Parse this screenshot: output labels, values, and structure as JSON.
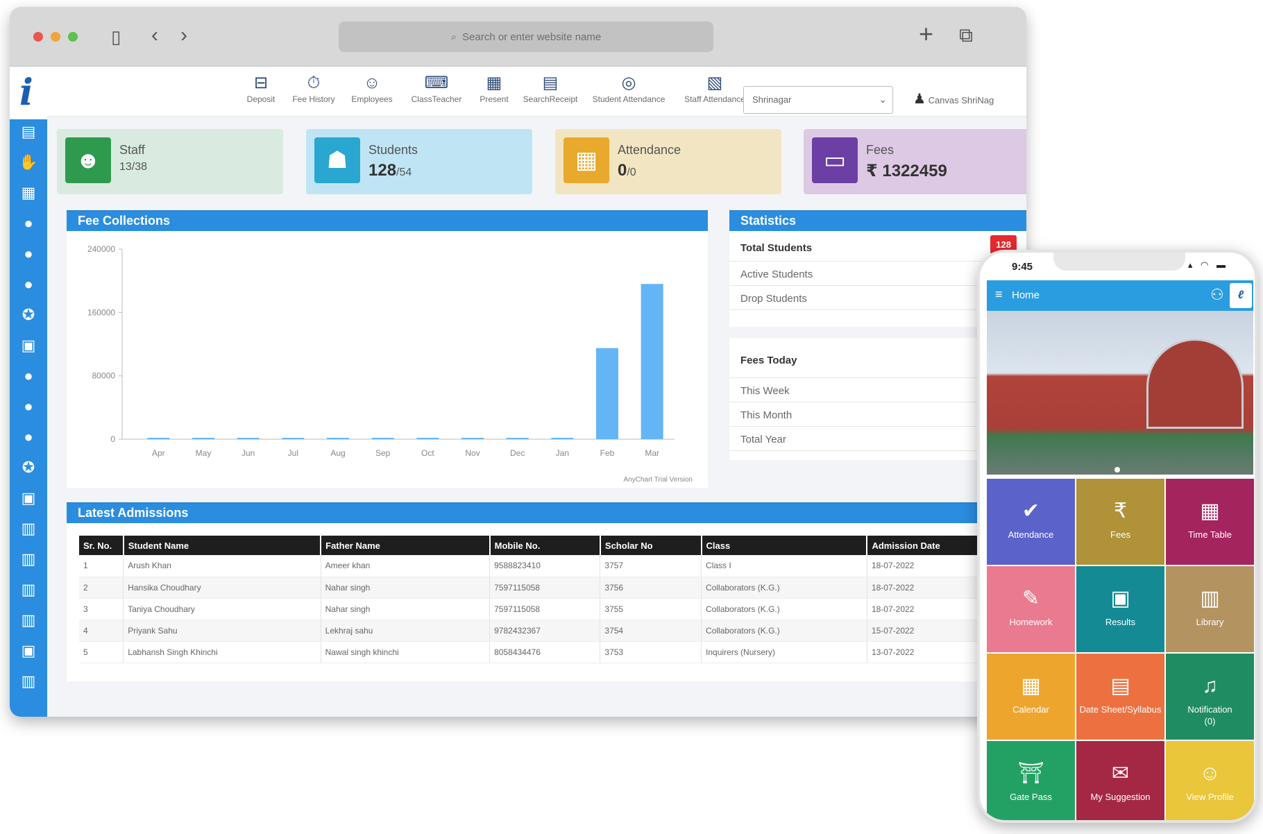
{
  "browser": {
    "url_placeholder": "Search or enter website name"
  },
  "toolbar": {
    "items": [
      {
        "label": "Deposit",
        "icon": "deposit-icon"
      },
      {
        "label": "Fee History",
        "icon": "fee-history-icon"
      },
      {
        "label": "Employees",
        "icon": "employees-icon"
      },
      {
        "label": "ClassTeacher",
        "icon": "class-teacher-icon"
      },
      {
        "label": "Present",
        "icon": "calendar-icon"
      },
      {
        "label": "SearchReceipt",
        "icon": "receipt-icon"
      },
      {
        "label": "Student Attendance",
        "icon": "student-attendance-icon"
      },
      {
        "label": "Staff Attendance",
        "icon": "staff-attendance-icon"
      }
    ],
    "branch_select": "Shrinagar",
    "user_name": "Canvas ShriNag"
  },
  "cards": {
    "staff": {
      "title": "Staff",
      "value": "13",
      "total": "/38",
      "color": "#2e9a4e"
    },
    "students": {
      "title": "Students",
      "value": "128",
      "total": "/54",
      "color": "#2aa7d0"
    },
    "attendance": {
      "title": "Attendance",
      "value": "0",
      "total": "/0",
      "color": "#e9a92c"
    },
    "fees": {
      "title": "Fees",
      "value": "₹ 1322459",
      "color": "#6c3fa5"
    }
  },
  "fee_panel": {
    "title": "Fee Collections",
    "watermark": "AnyChart Trial Version"
  },
  "chart_data": {
    "type": "bar",
    "categories": [
      "Apr",
      "May",
      "Jun",
      "Jul",
      "Aug",
      "Sep",
      "Oct",
      "Nov",
      "Dec",
      "Jan",
      "Feb",
      "Mar"
    ],
    "values": [
      0,
      0,
      0,
      0,
      0,
      0,
      0,
      0,
      0,
      0,
      115000,
      196000
    ],
    "ylim": [
      0,
      240000
    ],
    "yticks": [
      "0",
      "80000",
      "160000",
      "240000"
    ],
    "title": "",
    "xlabel": "",
    "ylabel": "",
    "grid": false,
    "bar_color": "#64b5f6"
  },
  "statistics": {
    "title": "Statistics",
    "total_students_label": "Total Students",
    "total_students_badge": "128",
    "rows": [
      "Active Students",
      "Drop Students"
    ]
  },
  "fees_today": {
    "label": "Fees Today",
    "badge": "₹",
    "rows": [
      "This Week",
      "This Month",
      "Total Year"
    ]
  },
  "admissions": {
    "title": "Latest Admissions",
    "columns": [
      "Sr. No.",
      "Student Name",
      "Father Name",
      "Mobile No.",
      "Scholar No",
      "Class",
      "Admission Date"
    ],
    "rows": [
      [
        "1",
        "Arush Khan",
        "Ameer khan",
        "9588823410",
        "3757",
        "Class I",
        "18-07-2022"
      ],
      [
        "2",
        "Hansika Choudhary",
        "Nahar singh",
        "7597115058",
        "3756",
        "Collaborators (K.G.)",
        "18-07-2022"
      ],
      [
        "3",
        "Taniya Choudhary",
        "Nahar singh",
        "7597115058",
        "3755",
        "Collaborators (K.G.)",
        "18-07-2022"
      ],
      [
        "4",
        "Priyank Sahu",
        "Lekhraj sahu",
        "9782432367",
        "3754",
        "Collaborators (K.G.)",
        "15-07-2022"
      ],
      [
        "5",
        "Labhansh Singh Khinchi",
        "Nawal singh khinchi",
        "8058434476",
        "3753",
        "Inquirers (Nursery)",
        "13-07-2022"
      ]
    ]
  },
  "phone": {
    "time": "9:45",
    "appbar_title": "Home",
    "tiles": [
      {
        "label": "Attendance",
        "icon": "attendance-icon",
        "color": "#5b62c9"
      },
      {
        "label": "Fees",
        "icon": "rupee-icon",
        "color": "#b09238"
      },
      {
        "label": "Time Table",
        "icon": "timetable-icon",
        "color": "#a4245e"
      },
      {
        "label": "Homework",
        "icon": "homework-icon",
        "color": "#ea7a8f"
      },
      {
        "label": "Results",
        "icon": "results-icon",
        "color": "#138a94"
      },
      {
        "label": "Library",
        "icon": "library-icon",
        "color": "#b39360"
      },
      {
        "label": "Calendar",
        "icon": "calendar-icon",
        "color": "#eea52e"
      },
      {
        "label": "Date Sheet/Syllabus",
        "icon": "datesheet-icon",
        "color": "#ed7140"
      },
      {
        "label": "Notification\n(0)",
        "icon": "bell-icon",
        "color": "#1f8c62"
      },
      {
        "label": "Gate Pass",
        "icon": "gate-pass-icon",
        "color": "#23a164"
      },
      {
        "label": "My Suggestion",
        "icon": "suggestion-icon",
        "color": "#a42844"
      },
      {
        "label": "View Profile",
        "icon": "profile-icon",
        "color": "#e9c63a"
      }
    ]
  }
}
